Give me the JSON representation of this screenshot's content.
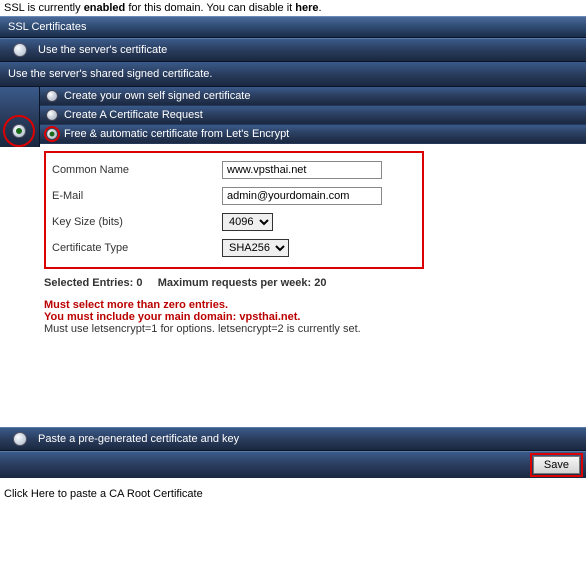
{
  "status": {
    "prefix": "SSL is currently ",
    "state": "enabled",
    "middle": " for this domain. You can disable it ",
    "here": "here",
    "suffix": "."
  },
  "header": {
    "title": "SSL Certificates"
  },
  "opt_server": {
    "label": "Use the server's certificate",
    "desc": "Use the server's shared signed certificate."
  },
  "cert_options": {
    "self_signed": "Create your own self signed certificate",
    "csr": "Create A Certificate Request",
    "letsencrypt": "Free & automatic certificate from Let's Encrypt"
  },
  "form": {
    "common_name": {
      "label": "Common Name",
      "value": "www.vpsthai.net"
    },
    "email": {
      "label": "E-Mail",
      "value": "admin@yourdomain.com"
    },
    "keysize": {
      "label": "Key Size (bits)",
      "value": "4096"
    },
    "cert_type": {
      "label": "Certificate Type",
      "value": "SHA256"
    }
  },
  "info": {
    "selected_label": "Selected Entries: ",
    "selected_value": "0",
    "max_label": "Maximum requests per week: ",
    "max_value": "20",
    "err1": "Must select more than zero entries.",
    "err2": "You must include your main domain: vpsthai.net.",
    "note": "Must use letsencrypt=1 for options. letsencrypt=2 is currently set."
  },
  "opt_paste": {
    "label": "Paste a pre-generated certificate and key"
  },
  "buttons": {
    "save": "Save"
  },
  "bottom_link": "Click Here to paste a CA Root Certificate"
}
